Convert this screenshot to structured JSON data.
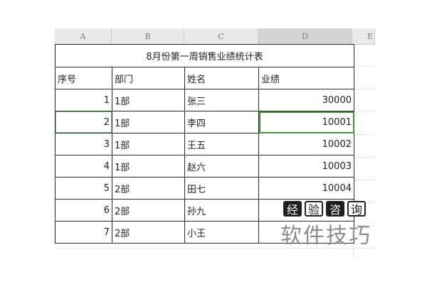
{
  "columns": [
    "A",
    "B",
    "C",
    "D",
    "E"
  ],
  "table": {
    "title": "8月份第一周销售业绩统计表",
    "headers": [
      "序号",
      "部门",
      "姓名",
      "业绩"
    ],
    "rows": [
      [
        "1",
        "1部",
        "张三",
        "30000"
      ],
      [
        "2",
        "1部",
        "李四",
        "10001"
      ],
      [
        "3",
        "1部",
        "王五",
        "10002"
      ],
      [
        "4",
        "1部",
        "赵六",
        "10003"
      ],
      [
        "5",
        "2部",
        "田七",
        "10004"
      ],
      [
        "6",
        "2部",
        "孙九",
        ""
      ],
      [
        "7",
        "2部",
        "小王",
        ""
      ]
    ]
  },
  "watermark": {
    "glyphs": [
      "经",
      "验",
      "咨",
      "询"
    ],
    "text": "软件技巧"
  }
}
